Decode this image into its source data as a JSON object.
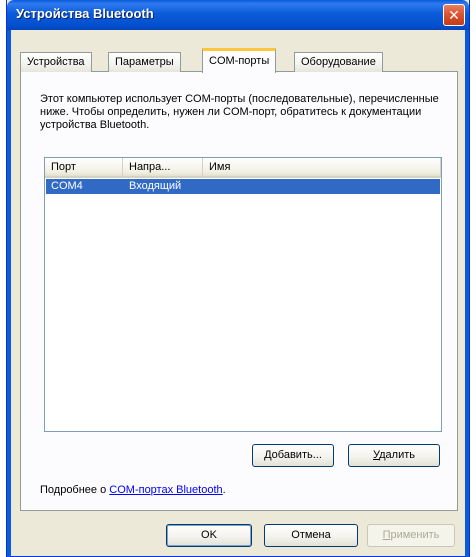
{
  "window": {
    "title": "Устройства Bluetooth"
  },
  "tabs": [
    {
      "label": "Устройства"
    },
    {
      "label": "Параметры"
    },
    {
      "label": "COM-порты"
    },
    {
      "label": "Оборудование"
    }
  ],
  "description": "Этот компьютер использует COM-порты (последовательные), перечисленные ниже. Чтобы определить, нужен ли COM-порт, обратитесь к документации устройства Bluetooth.",
  "list": {
    "columns": [
      "Порт",
      "Напра...",
      "Имя"
    ],
    "rows": [
      {
        "port": "COM4",
        "direction": "Входящий",
        "name": ""
      }
    ]
  },
  "buttons": {
    "add_accel": "Д",
    "add_rest": "обавить...",
    "remove_accel": "У",
    "remove_rest": "далить",
    "ok": "OK",
    "cancel": "Отмена",
    "apply_accel": "П",
    "apply_rest": "рименить"
  },
  "more_info": {
    "prefix": "Подробнее о ",
    "link": "COM-портах Bluetooth",
    "suffix": "."
  }
}
